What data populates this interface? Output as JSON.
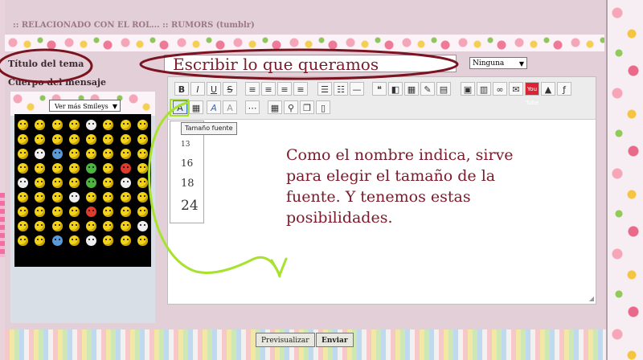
{
  "breadcrumb": ":: RELACIONADO CON EL ROL... :: RUMORS (tumblr)",
  "labels": {
    "topic_title": "Título del tema",
    "message_body": "Cuerpo del mensaje"
  },
  "title_input": {
    "value": "Escribir lo que queramos"
  },
  "topic_type_select": {
    "selected": "Ninguna"
  },
  "smileys": {
    "selector": "Ver más Smileys"
  },
  "toolbar": {
    "bold": "B",
    "italic": "I",
    "underline": "U",
    "strike": "S",
    "youtube_label": "You Tube"
  },
  "tooltip": "Tamaño fuente",
  "font_sizes": [
    "13",
    "16",
    "18",
    "24"
  ],
  "editor": {
    "text": "Como el nombre indica, sirve para elegir el tamaño de la fuente. Y tenemos estas posibilidades."
  },
  "buttons": {
    "preview": "Previsualizar",
    "send": "Enviar"
  },
  "colors": {
    "annotation_marker": "#7a1420",
    "annotation_highlight": "#a6e22e",
    "editor_text": "#7a1a2a"
  }
}
